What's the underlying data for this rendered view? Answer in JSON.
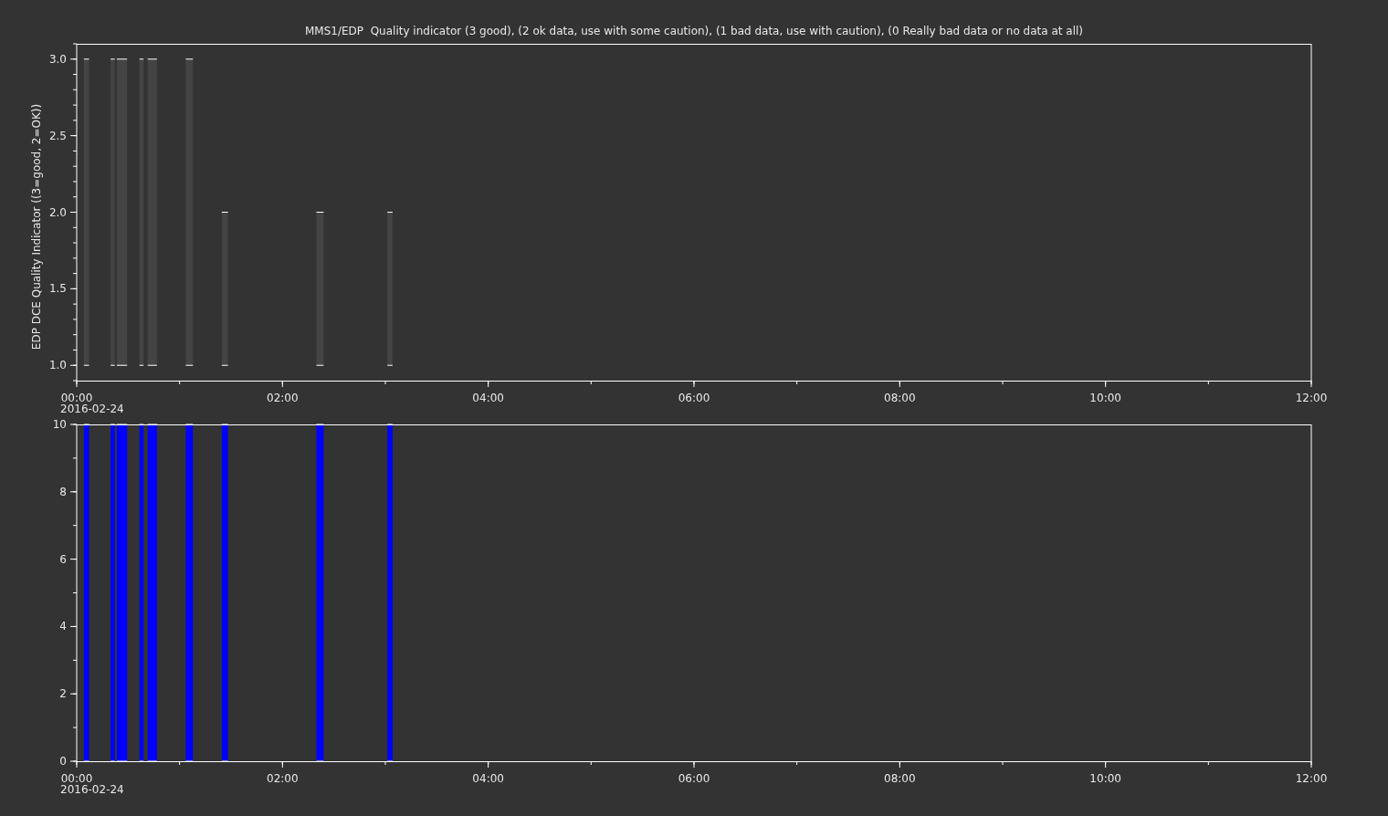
{
  "title": "MMS1/EDP  Quality indicator (3 good), (2 ok data, use with some caution), (1 bad data, use with caution), (0 Really bad data or no data at all)",
  "panels": [
    {
      "date_label": "2016-02-24",
      "chart_data": {
        "type": "area",
        "ylabel": "EDP DCE Quality Indicator ((3=good, 2=OK))",
        "xlim": [
          0,
          12
        ],
        "ylim": [
          0.9,
          3.1
        ],
        "xticks": [
          {
            "value": 0,
            "label": "00:00"
          },
          {
            "value": 2,
            "label": "02:00"
          },
          {
            "value": 4,
            "label": "04:00"
          },
          {
            "value": 6,
            "label": "06:00"
          },
          {
            "value": 8,
            "label": "08:00"
          },
          {
            "value": 10,
            "label": "10:00"
          },
          {
            "value": 12,
            "label": "12:00"
          }
        ],
        "yticks": [
          {
            "value": 1,
            "label": "1.0"
          },
          {
            "value": 1.5,
            "label": "1.5"
          },
          {
            "value": 2,
            "label": "2.0"
          },
          {
            "value": 2.5,
            "label": "2.5"
          },
          {
            "value": 3,
            "label": "3.0"
          }
        ],
        "x": [
          0.07,
          0.12,
          0.2,
          0.33,
          0.37,
          0.38,
          0.39,
          0.49,
          0.55,
          0.61,
          0.65,
          0.67,
          0.69,
          0.78,
          0.9,
          1.06,
          1.13,
          1.3,
          1.41,
          1.47,
          1.9,
          2.33,
          2.4,
          2.7,
          3.02,
          3.07
        ],
        "series": [
          {
            "color": "#444444",
            "values": [
              3,
              3,
              null,
              3,
              3,
              null,
              3,
              3,
              null,
              3,
              3,
              null,
              3,
              3,
              null,
              3,
              3,
              null,
              2,
              2,
              null,
              2,
              2,
              null,
              2,
              2
            ]
          }
        ]
      }
    },
    {
      "date_label": "2016-02-24",
      "chart_data": {
        "type": "area",
        "xlim": [
          0,
          12
        ],
        "ylim": [
          0,
          10
        ],
        "xticks": [
          {
            "value": 0,
            "label": "00:00"
          },
          {
            "value": 2,
            "label": "02:00"
          },
          {
            "value": 4,
            "label": "04:00"
          },
          {
            "value": 6,
            "label": "06:00"
          },
          {
            "value": 8,
            "label": "08:00"
          },
          {
            "value": 10,
            "label": "10:00"
          },
          {
            "value": 12,
            "label": "12:00"
          }
        ],
        "yticks": [
          {
            "value": 0,
            "label": "0"
          },
          {
            "value": 2,
            "label": "2"
          },
          {
            "value": 4,
            "label": "4"
          },
          {
            "value": 6,
            "label": "6"
          },
          {
            "value": 8,
            "label": "8"
          },
          {
            "value": 10,
            "label": "10"
          }
        ],
        "x": [
          0.07,
          0.12,
          0.2,
          0.33,
          0.37,
          0.38,
          0.39,
          0.49,
          0.55,
          0.61,
          0.65,
          0.67,
          0.69,
          0.78,
          0.9,
          1.06,
          1.13,
          1.3,
          1.41,
          1.47,
          1.9,
          2.33,
          2.4,
          2.7,
          3.02,
          3.07
        ],
        "series": [
          {
            "color": "#0000ff",
            "values": [
              10,
              10,
              null,
              10,
              10,
              null,
              10,
              10,
              null,
              10,
              10,
              null,
              10,
              10,
              null,
              10,
              10,
              null,
              10,
              10,
              null,
              10,
              10,
              null,
              10,
              10
            ]
          }
        ]
      }
    }
  ]
}
